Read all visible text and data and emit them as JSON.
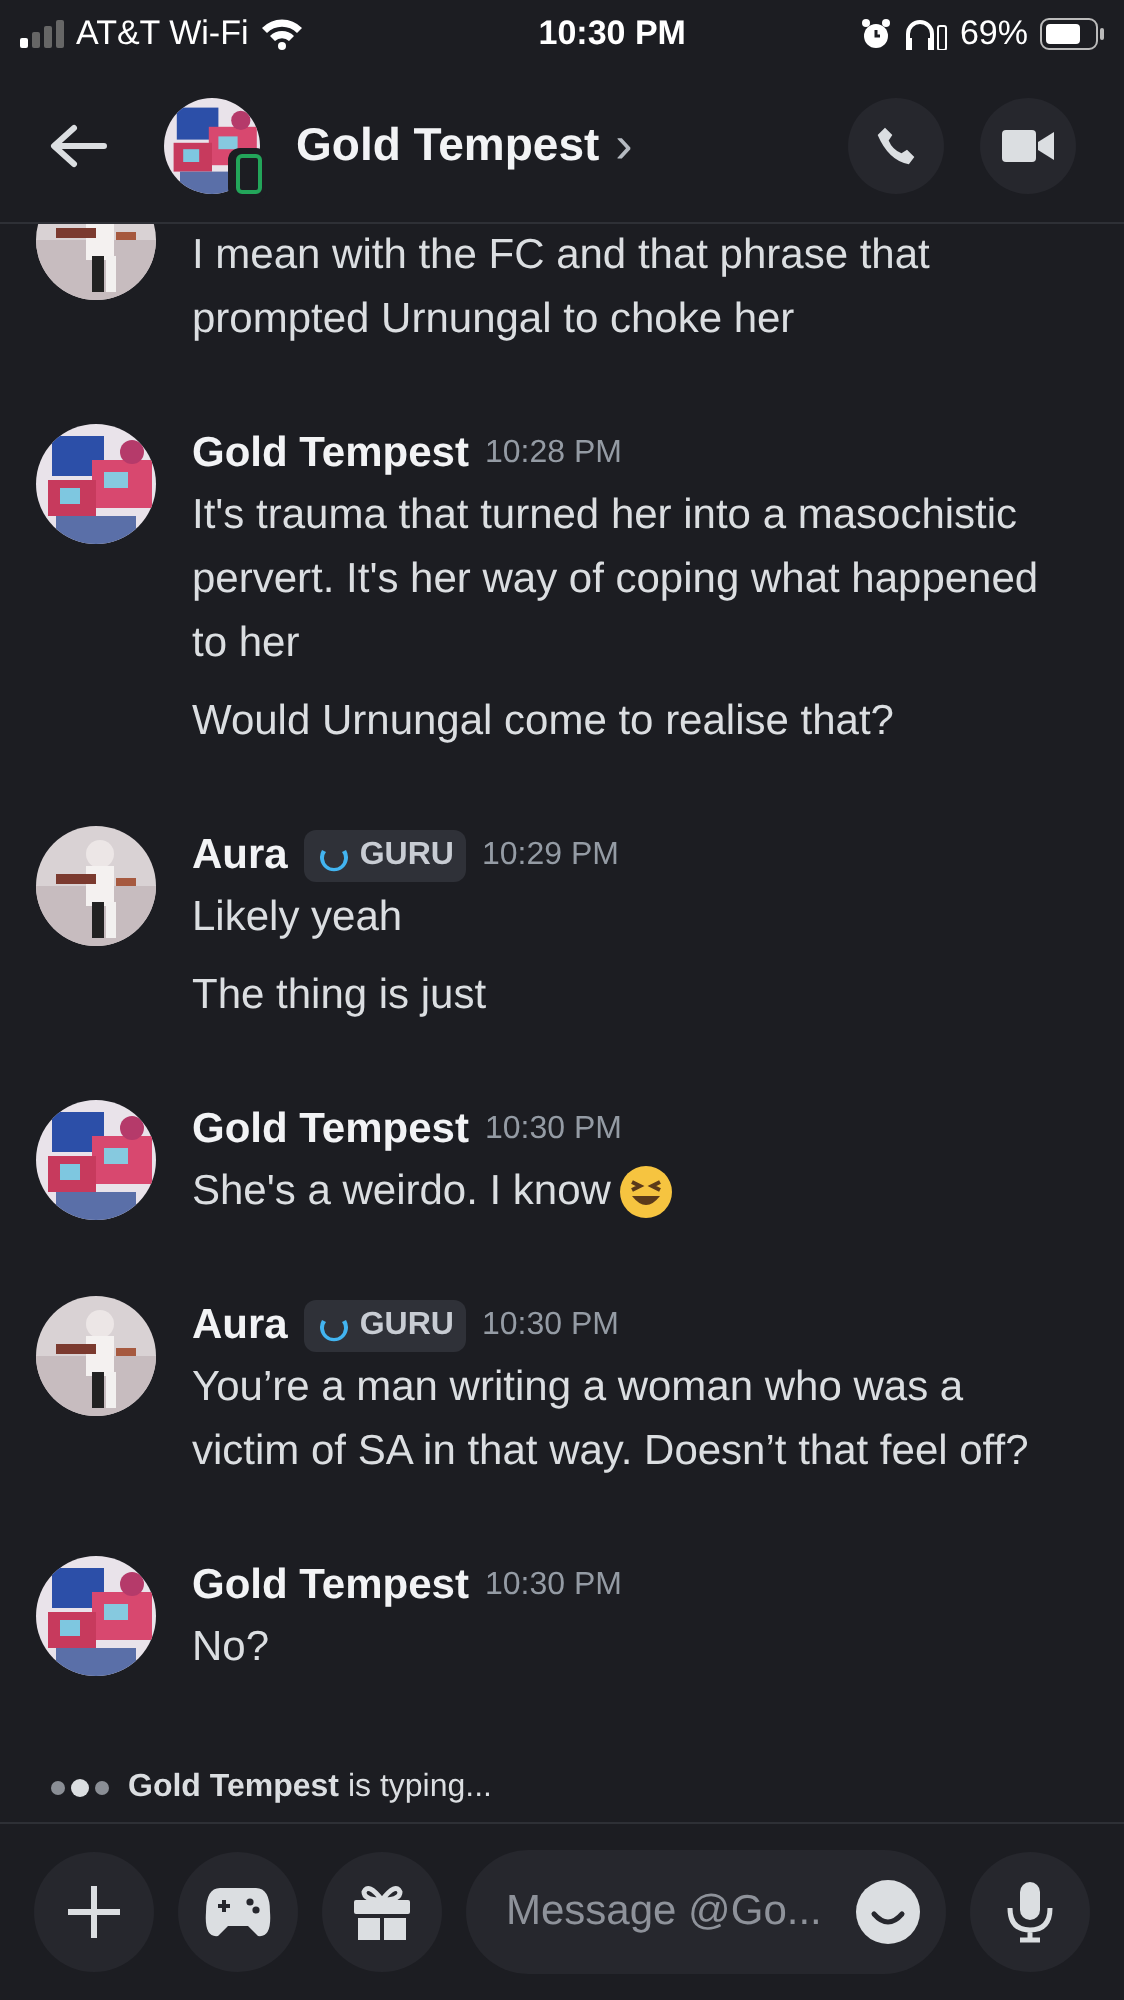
{
  "status_bar": {
    "carrier": "AT&T Wi-Fi",
    "time": "10:30 PM",
    "battery": "69%"
  },
  "header": {
    "title": "Gold Tempest",
    "chevron": "›"
  },
  "messages": [
    {
      "kind": "aura",
      "lines": [
        "I mean with the FC and that phrase that prompted Urnungal to choke her"
      ]
    },
    {
      "kind": "robot",
      "author": "Gold Tempest",
      "time": "10:28 PM",
      "lines": [
        "It's trauma that turned her into a masochistic pervert. It's her way of coping what happened to her",
        "Would Urnungal come to realise that?"
      ]
    },
    {
      "kind": "aura",
      "author": "Aura",
      "badge": "GURU",
      "time": "10:29 PM",
      "lines": [
        "Likely yeah",
        "The thing is just"
      ]
    },
    {
      "kind": "robot",
      "author": "Gold Tempest",
      "time": "10:30 PM",
      "lines": [
        "She's a weirdo. I know"
      ],
      "emoji": true
    },
    {
      "kind": "aura",
      "author": "Aura",
      "badge": "GURU",
      "time": "10:30 PM",
      "lines": [
        "You’re a man writing a woman who was a victim of SA in that way. Doesn’t that feel off?"
      ]
    },
    {
      "kind": "robot",
      "author": "Gold Tempest",
      "time": "10:30 PM",
      "lines": [
        "No?"
      ]
    }
  ],
  "typing": {
    "name": "Gold Tempest",
    "text": "is typing..."
  },
  "composer": {
    "placeholder": "Message @Go..."
  }
}
